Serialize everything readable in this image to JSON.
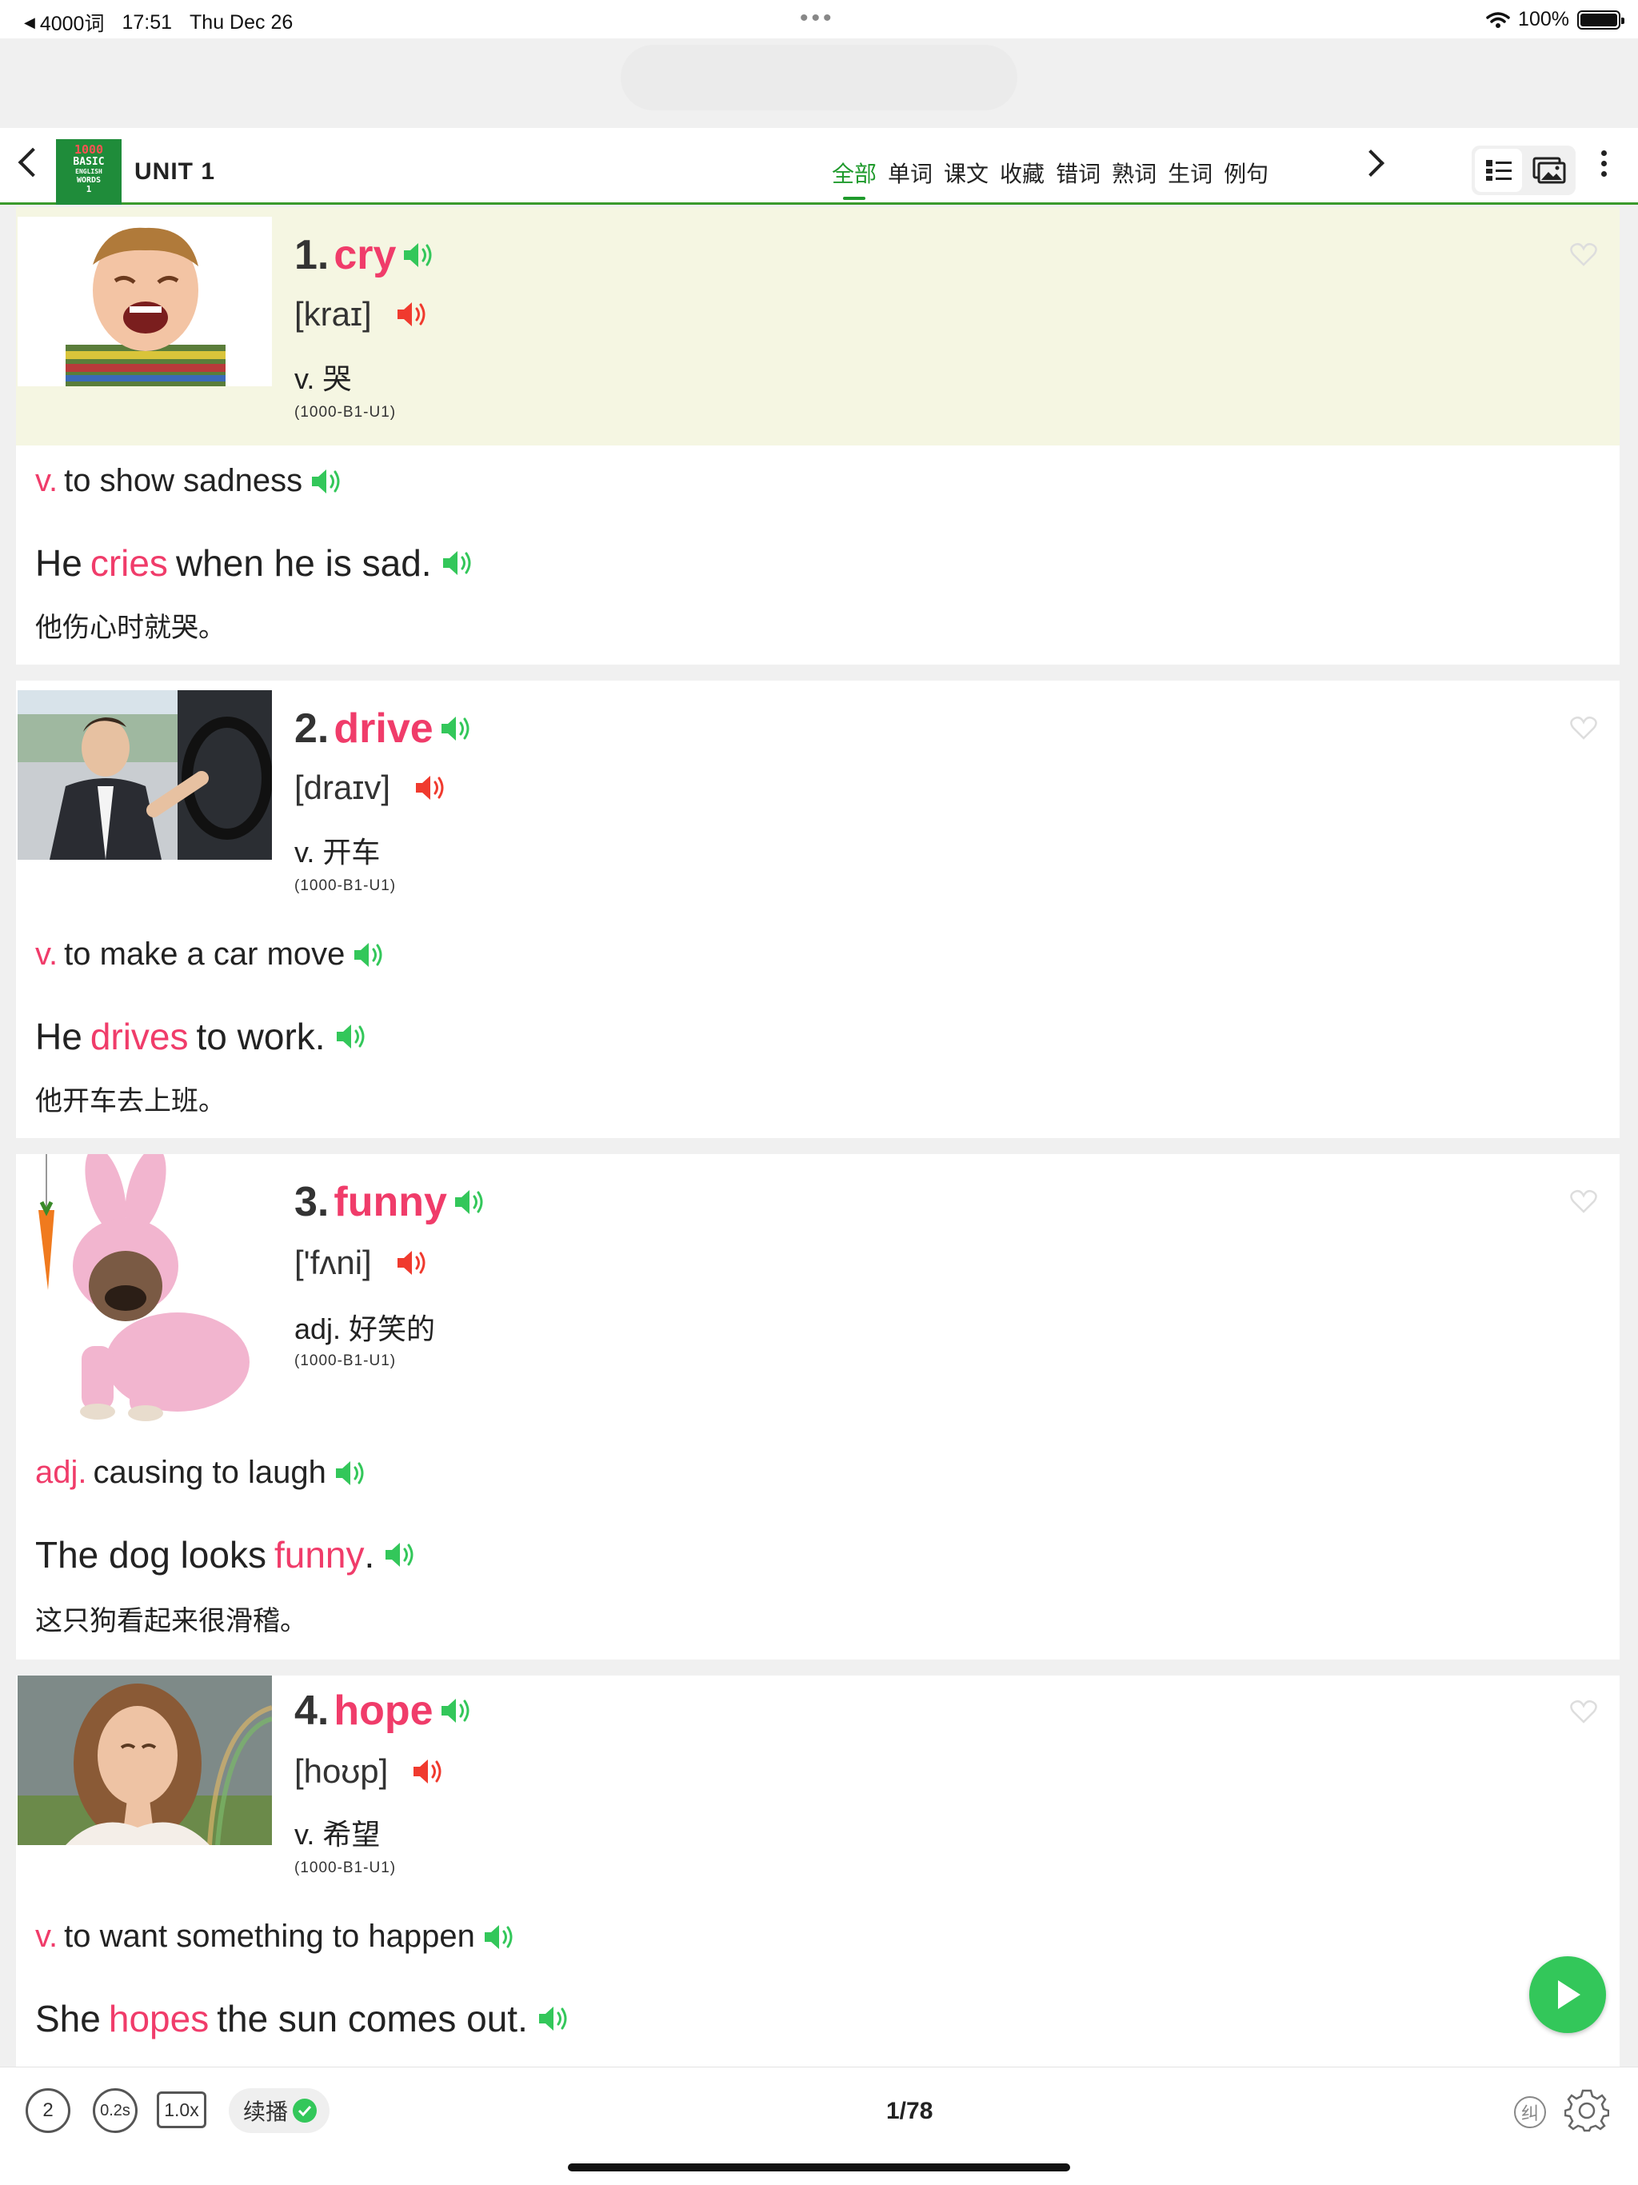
{
  "status_bar": {
    "back_app": "4000词",
    "time": "17:51",
    "date": "Thu Dec 26",
    "battery": "100%"
  },
  "header": {
    "book_cover": {
      "number": "1000",
      "line1": "BASIC",
      "line2": "ENGLISH",
      "line3": "WORDS",
      "line4": "1"
    },
    "title": "UNIT 1",
    "tabs": [
      "全部",
      "单词",
      "课文",
      "收藏",
      "错词",
      "熟词",
      "生词",
      "例句"
    ],
    "active_tab": "全部"
  },
  "cards": [
    {
      "number": "1.",
      "word": "cry",
      "phonetic": "[kraɪ]",
      "meaning": "v. 哭",
      "level": "(1000-B1-U1)",
      "def_pos": "v.",
      "def_text": "to show sadness",
      "ex_before": "He",
      "ex_keyword": "cries",
      "ex_after": "when he is sad.",
      "translation": "他伤心时就哭。"
    },
    {
      "number": "2.",
      "word": "drive",
      "phonetic": "[draɪv]",
      "meaning": "v. 开车",
      "level": "(1000-B1-U1)",
      "def_pos": "v.",
      "def_text": "to make a car move",
      "ex_before": "He",
      "ex_keyword": "drives",
      "ex_after": "to work.",
      "translation": "他开车去上班。"
    },
    {
      "number": "3.",
      "word": "funny",
      "phonetic": "['fʌni]",
      "meaning": "adj. 好笑的",
      "level": "(1000-B1-U1)",
      "def_pos": "adj.",
      "def_text": "causing to laugh",
      "ex_before": "The dog looks",
      "ex_keyword": "funny",
      "ex_after": ".",
      "translation": "这只狗看起来很滑稽。"
    },
    {
      "number": "4.",
      "word": "hope",
      "phonetic": "[hoʊp]",
      "meaning": "v. 希望",
      "level": "(1000-B1-U1)",
      "def_pos": "v.",
      "def_text": "to want something to happen",
      "ex_before": "She",
      "ex_keyword": "hopes",
      "ex_after": "the sun comes out.",
      "translation": ""
    }
  ],
  "bottom_bar": {
    "repeat_count": "2",
    "interval": "0.2s",
    "speed": "1.0x",
    "continue_label": "续播",
    "page_indicator": "1/78",
    "correction_label": "纠"
  },
  "colors": {
    "accent_green": "#1f9a2c",
    "keyword_pink": "#f03c6a",
    "speaker_green": "#33c75a",
    "speaker_red": "#f03a2e",
    "highlight_bg": "#f5f6e2"
  },
  "icons": [
    "back-chevron-icon",
    "next-chevron-icon",
    "list-view-icon",
    "image-view-icon",
    "more-icon",
    "speaker-icon",
    "heart-icon",
    "play-icon",
    "settings-gear-icon",
    "wifi-icon",
    "battery-icon"
  ]
}
